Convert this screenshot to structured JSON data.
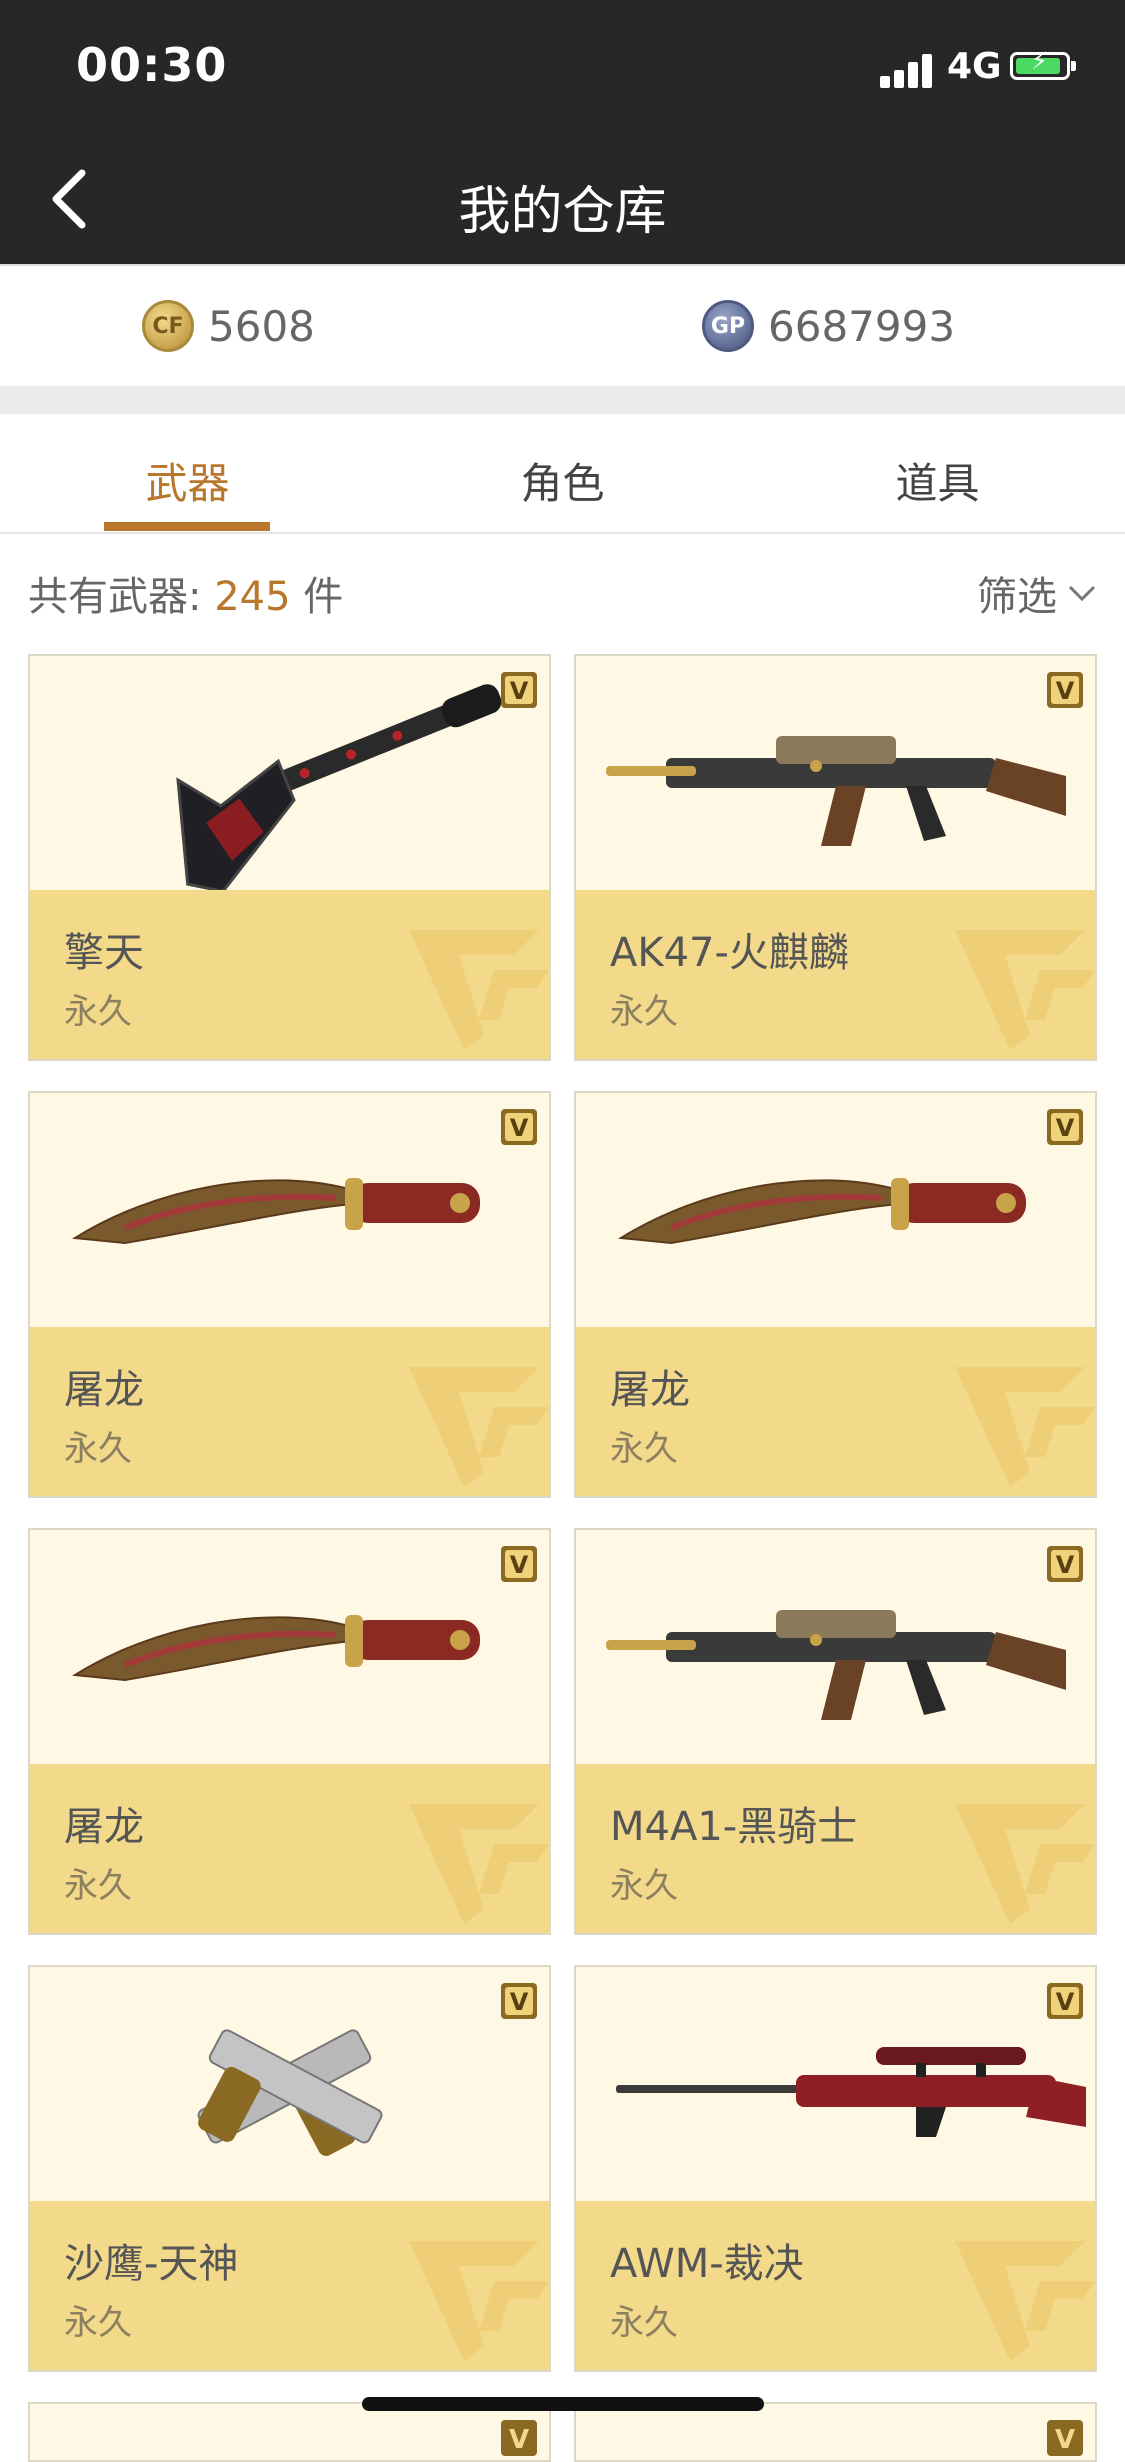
{
  "status_bar": {
    "time": "00:30",
    "network": "4G"
  },
  "nav": {
    "title": "我的仓库"
  },
  "currency": {
    "cf_points": "5608",
    "gp_points": "6687993"
  },
  "tabs": [
    {
      "label": "武器",
      "active": true
    },
    {
      "label": "角色",
      "active": false
    },
    {
      "label": "道具",
      "active": false
    }
  ],
  "summary": {
    "prefix": "共有武器: ",
    "count": "245",
    "suffix": " 件",
    "filter_label": "筛选"
  },
  "items": [
    {
      "name": "擎天",
      "duration": "永久",
      "icon": "shovel-icon"
    },
    {
      "name": "AK47-火麒麟",
      "duration": "永久",
      "icon": "rifle-icon"
    },
    {
      "name": "屠龙",
      "duration": "永久",
      "icon": "kukri-icon"
    },
    {
      "name": "屠龙",
      "duration": "永久",
      "icon": "kukri-icon"
    },
    {
      "name": "屠龙",
      "duration": "永久",
      "icon": "kukri-icon"
    },
    {
      "name": "M4A1-黑骑士",
      "duration": "永久",
      "icon": "rifle-icon"
    },
    {
      "name": "沙鹰-天神",
      "duration": "永久",
      "icon": "pistol-icon"
    },
    {
      "name": "AWM-裁决",
      "duration": "永久",
      "icon": "sniper-icon"
    }
  ],
  "colors": {
    "accent": "#b8772c",
    "header": "#272727",
    "card_top": "#fff8e4",
    "card_bottom": "#f3da8a"
  }
}
